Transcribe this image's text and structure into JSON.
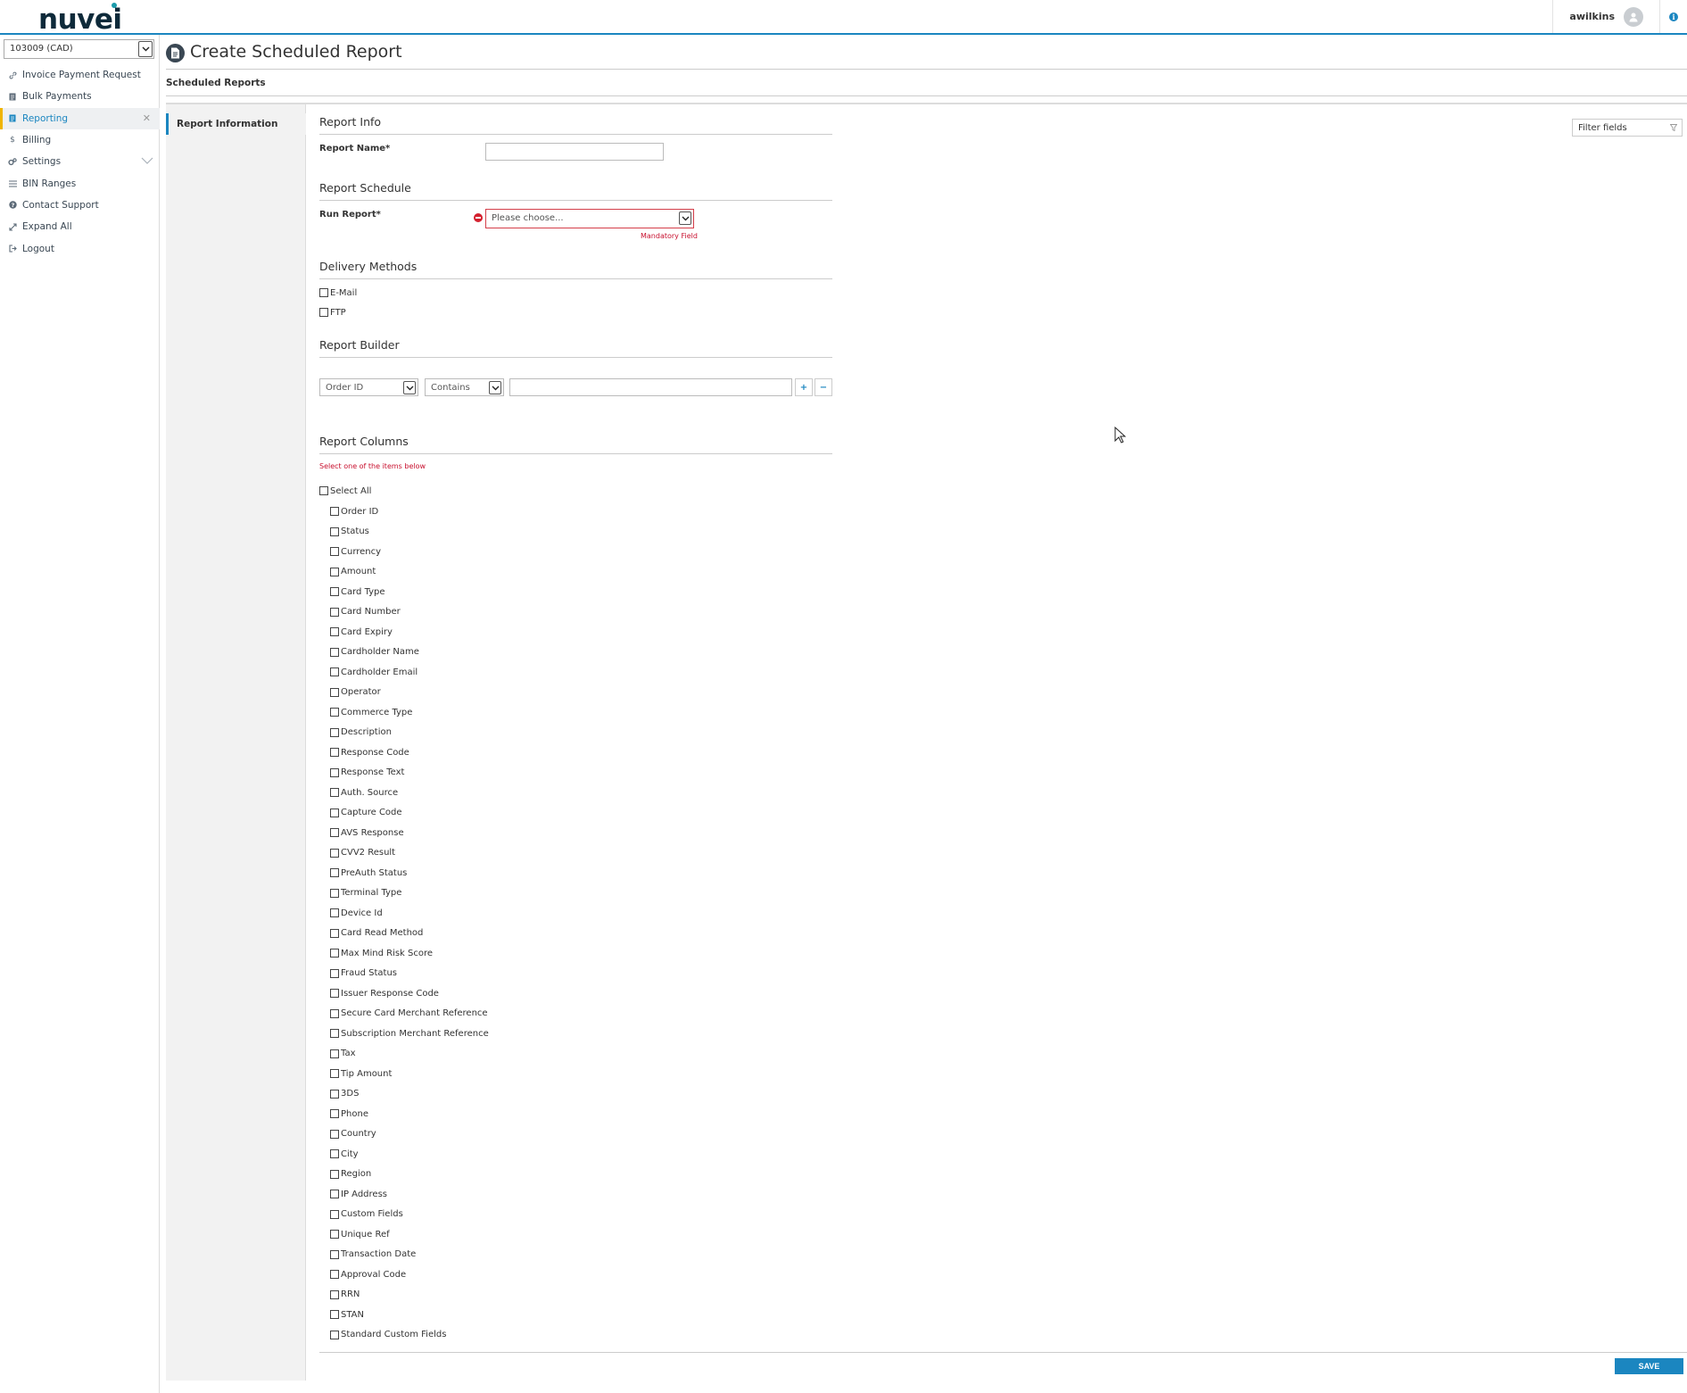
{
  "header": {
    "logo": "nuvei",
    "user": "awilkins"
  },
  "sidebar": {
    "merchant": "103009 (CAD)",
    "items": [
      {
        "label": "Invoice Payment Request",
        "icon": "link-icon"
      },
      {
        "label": "Bulk Payments",
        "icon": "document-icon"
      },
      {
        "label": "Reporting",
        "icon": "report-icon",
        "active": true
      },
      {
        "label": "Billing",
        "icon": "dollar-icon"
      },
      {
        "label": "Settings",
        "icon": "gears-icon"
      },
      {
        "label": "BIN Ranges",
        "icon": "list-icon"
      },
      {
        "label": "Contact Support",
        "icon": "question-icon"
      },
      {
        "label": "Expand All",
        "icon": "expand-icon"
      },
      {
        "label": "Logout",
        "icon": "logout-icon"
      }
    ]
  },
  "page": {
    "title": "Create Scheduled Report",
    "breadcrumb": "Scheduled Reports",
    "subtab": "Report Information",
    "filter_placeholder": "Filter fields"
  },
  "form": {
    "report_info": {
      "title": "Report Info",
      "name_label": "Report Name*",
      "name_value": ""
    },
    "schedule": {
      "title": "Report Schedule",
      "run_label": "Run Report*",
      "run_value": "Please choose...",
      "error": "Mandatory Field"
    },
    "delivery": {
      "title": "Delivery Methods",
      "options": [
        "E-Mail",
        "FTP"
      ]
    },
    "builder": {
      "title": "Report Builder",
      "field": "Order ID",
      "operator": "Contains",
      "value": "",
      "add": "+",
      "remove": "−"
    },
    "columns": {
      "title": "Report Columns",
      "hint": "Select one of the items below",
      "select_all": "Select All",
      "items": [
        "Order ID",
        "Status",
        "Currency",
        "Amount",
        "Card Type",
        "Card Number",
        "Card Expiry",
        "Cardholder Name",
        "Cardholder Email",
        "Operator",
        "Commerce Type",
        "Description",
        "Response Code",
        "Response Text",
        "Auth. Source",
        "Capture Code",
        "AVS Response",
        "CVV2 Result",
        "PreAuth Status",
        "Terminal Type",
        "Device Id",
        "Card Read Method",
        "Max Mind Risk Score",
        "Fraud Status",
        "Issuer Response Code",
        "Secure Card Merchant Reference",
        "Subscription Merchant Reference",
        "Tax",
        "Tip Amount",
        "3DS",
        "Phone",
        "Country",
        "City",
        "Region",
        "IP Address",
        "Custom Fields",
        "Unique Ref",
        "Transaction Date",
        "Approval Code",
        "RRN",
        "STAN",
        "Standard Custom Fields"
      ]
    }
  },
  "actions": {
    "save": "SAVE"
  },
  "colors": {
    "accent": "#1b86c0",
    "active_marker": "#f0b400",
    "error": "#c8102e"
  }
}
